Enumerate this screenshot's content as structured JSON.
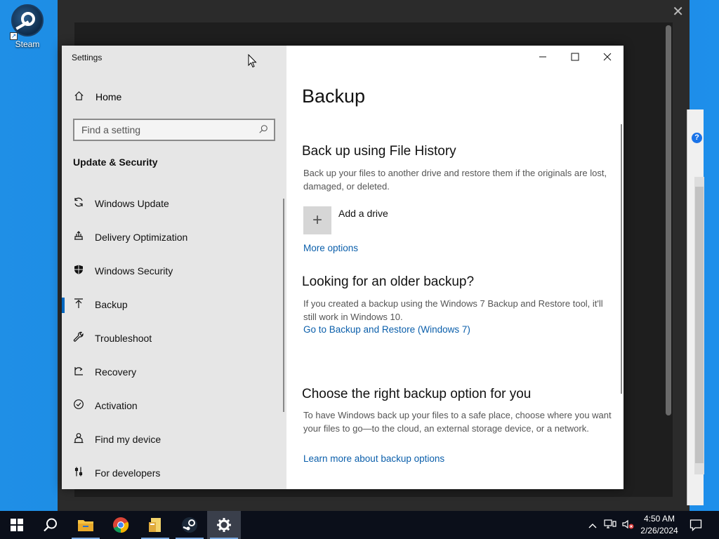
{
  "desktop": {
    "icons": [
      {
        "label": "Steam"
      }
    ]
  },
  "settings": {
    "title": "Settings",
    "home_label": "Home",
    "search_placeholder": "Find a setting",
    "category": "Update & Security",
    "nav_items": [
      {
        "label": "Windows Update",
        "icon": "refresh-icon"
      },
      {
        "label": "Delivery Optimization",
        "icon": "delivery-icon"
      },
      {
        "label": "Windows Security",
        "icon": "shield-icon"
      },
      {
        "label": "Backup",
        "icon": "backup-icon",
        "active": true
      },
      {
        "label": "Troubleshoot",
        "icon": "wrench-icon"
      },
      {
        "label": "Recovery",
        "icon": "recovery-icon"
      },
      {
        "label": "Activation",
        "icon": "check-circle-icon"
      },
      {
        "label": "Find my device",
        "icon": "person-icon"
      },
      {
        "label": "For developers",
        "icon": "developer-icon"
      }
    ],
    "page": {
      "title": "Backup",
      "file_history": {
        "heading": "Back up using File History",
        "description": "Back up your files to another drive and restore them if the originals are lost, damaged, or deleted.",
        "add_drive_label": "Add a drive",
        "more_options_link": "More options"
      },
      "older_backup": {
        "heading": "Looking for an older backup?",
        "description": "If you created a backup using the Windows 7 Backup and Restore tool, it'll still work in Windows 10.",
        "link": "Go to Backup and Restore (Windows 7)"
      },
      "choose": {
        "heading": "Choose the right backup option for you",
        "description": "To have Windows back up your files to a safe place, choose where you want your files to go—to the cloud, an external storage device, or a network.",
        "link": "Learn more about backup options"
      }
    }
  },
  "taskbar": {
    "time": "4:50 AM",
    "date": "2/26/2024",
    "apps": [
      "start",
      "search",
      "file-explorer",
      "chrome",
      "file-manager",
      "steam",
      "settings"
    ]
  },
  "colors": {
    "accent": "#0067c0",
    "link": "#0b5fab",
    "nav_bg": "#e6e6e6",
    "desktop": "#1a84e0",
    "taskbar": "#0b0f1a"
  }
}
